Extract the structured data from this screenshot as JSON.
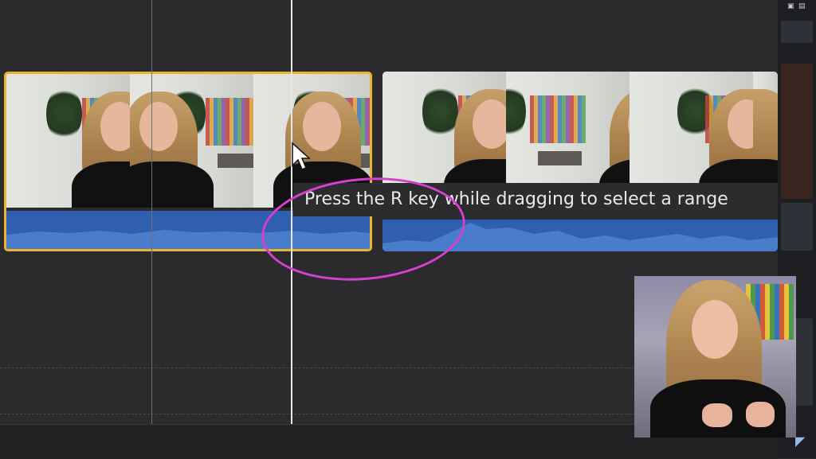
{
  "tooltip": {
    "text": "Press the R key while dragging to select a range"
  },
  "playhead": {
    "color": "#e6e6e6"
  },
  "selection": {
    "border_color": "#e8b530",
    "annotation_color": "#d63fcf"
  },
  "audio": {
    "color": "#2f5fae"
  },
  "icons": [
    "pointer-cursor-icon",
    "app-logo-icon"
  ]
}
